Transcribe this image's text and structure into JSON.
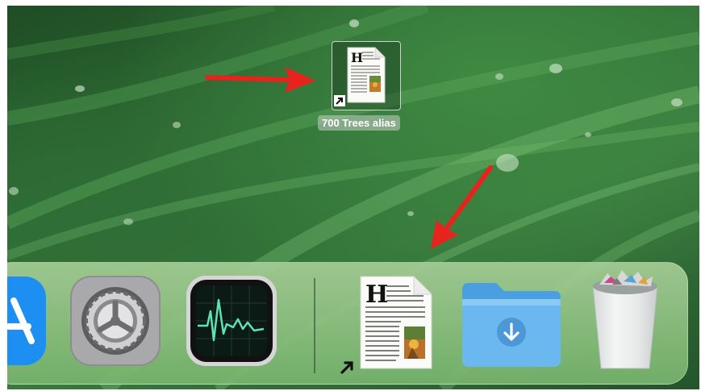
{
  "desktop": {
    "alias_icon": {
      "label": "700 Trees alias",
      "icon": "text-document-icon"
    }
  },
  "dock": {
    "items": [
      {
        "icon": "app-store-icon"
      },
      {
        "icon": "system-preferences-icon"
      },
      {
        "icon": "activity-monitor-icon"
      },
      {
        "icon": "text-document-alias-icon"
      },
      {
        "icon": "downloads-folder-icon"
      },
      {
        "icon": "trash-full-icon"
      }
    ]
  },
  "annotations": {
    "arrow_color": "#e8231d"
  }
}
